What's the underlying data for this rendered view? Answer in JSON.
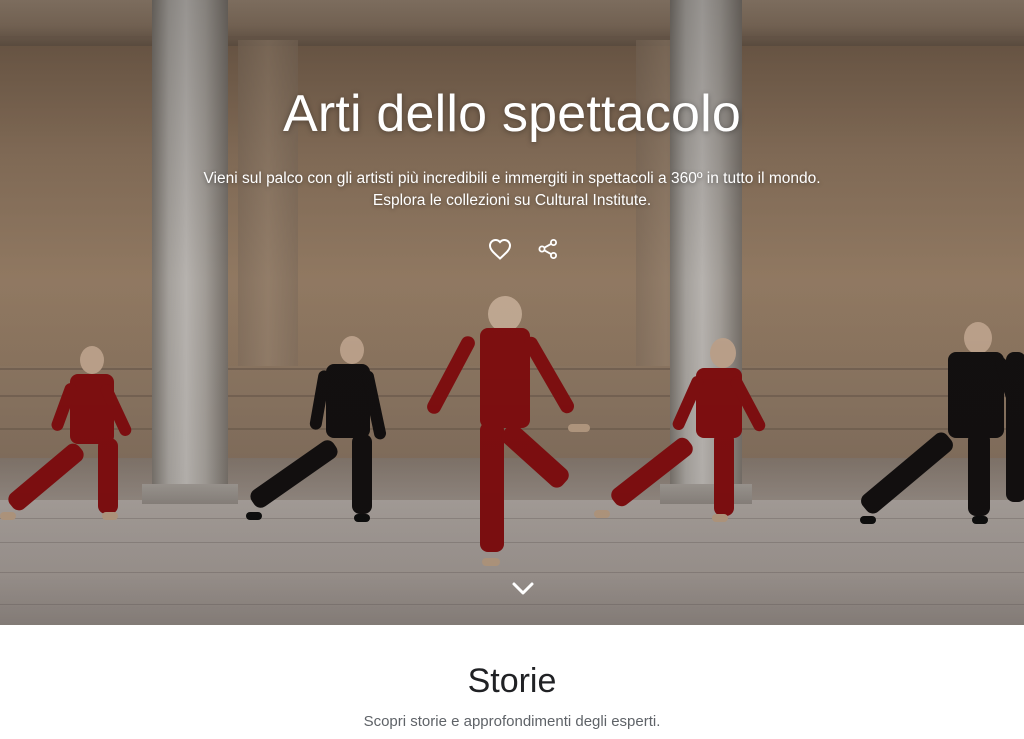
{
  "hero": {
    "title": "Arti dello spettacolo",
    "subtitle_line1": "Vieni sul palco con gli artisti più incredibili e immergiti in spettacoli a 360º in tutto il mondo.",
    "subtitle_line2": "Esplora le collezioni su Cultural Institute.",
    "actions": {
      "favorite_icon": "heart-outline-icon",
      "share_icon": "share-icon"
    },
    "scroll_icon": "chevron-down-icon"
  },
  "stories": {
    "title": "Storie",
    "subtitle": "Scopri storie e approfondimenti degli esperti."
  },
  "colors": {
    "overlay_text": "#ffffff",
    "section_title": "#202124",
    "section_subtitle": "#5f6368",
    "costume_red": "#9a1214",
    "costume_black": "#161313"
  }
}
